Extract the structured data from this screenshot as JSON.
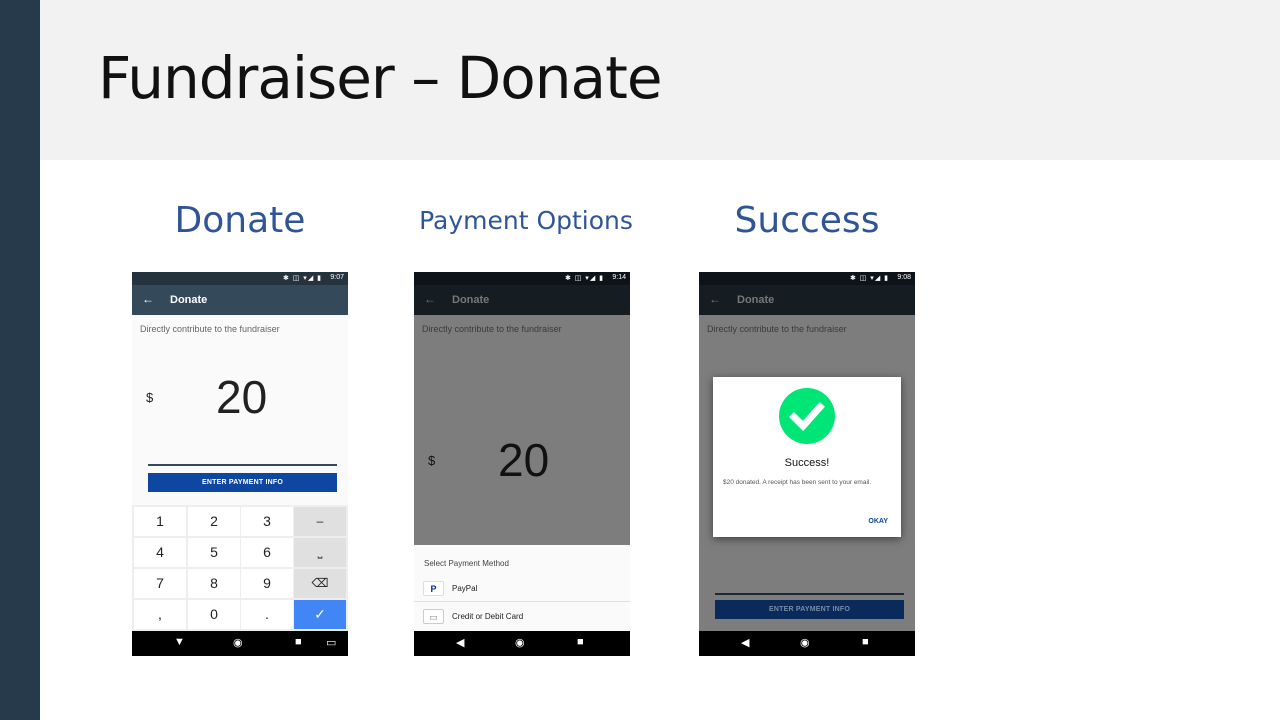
{
  "slide": {
    "title": "Fundraiser – Donate",
    "headings": [
      "Donate",
      "Payment Options",
      "Success"
    ]
  },
  "phones": [
    {
      "status_time": "9:07",
      "status_icons": "✱ ◫ ▾◢ ▮",
      "appbar_title": "Donate",
      "back": "←",
      "description": "Directly contribute to the fundraiser",
      "currency": "$",
      "amount": "20",
      "button": "ENTER PAYMENT INFO",
      "keypad": {
        "row1": [
          "1",
          "2",
          "3",
          "–"
        ],
        "row2": [
          "4",
          "5",
          "6",
          "⎵"
        ],
        "row3": [
          "7",
          "8",
          "9",
          "⌫"
        ],
        "row4": [
          ",",
          "0",
          ".",
          "✓"
        ]
      },
      "nav": [
        "▼",
        "◉",
        "■",
        "▭"
      ]
    },
    {
      "status_time": "9:14",
      "status_icons": "✱ ◫ ▾◢ ▮",
      "appbar_title": "Donate",
      "back": "←",
      "description": "Directly contribute to the fundraiser",
      "currency": "$",
      "amount": "20",
      "sheet_title": "Select Payment Method",
      "methods": [
        {
          "icon": "P",
          "label": "PayPal"
        },
        {
          "icon": "▭",
          "label": "Credit or Debit Card"
        }
      ],
      "nav": [
        "◀",
        "◉",
        "■"
      ]
    },
    {
      "status_time": "9:08",
      "status_icons": "✱ ◫ ▾◢ ▮",
      "appbar_title": "Donate",
      "back": "←",
      "description": "Directly contribute to the fundraiser",
      "button": "ENTER PAYMENT INFO",
      "dialog": {
        "title": "Success!",
        "message": "$20 donated. A receipt has been sent to your email.",
        "action": "OKAY"
      },
      "nav": [
        "◀",
        "◉",
        "■"
      ]
    }
  ],
  "colors": {
    "left_bar": "#273a4b",
    "heading": "#2f5597",
    "app_bar": "#34495a",
    "primary_button": "#0d47a1",
    "success_check": "#00e676",
    "keypad_done": "#4285f4"
  }
}
